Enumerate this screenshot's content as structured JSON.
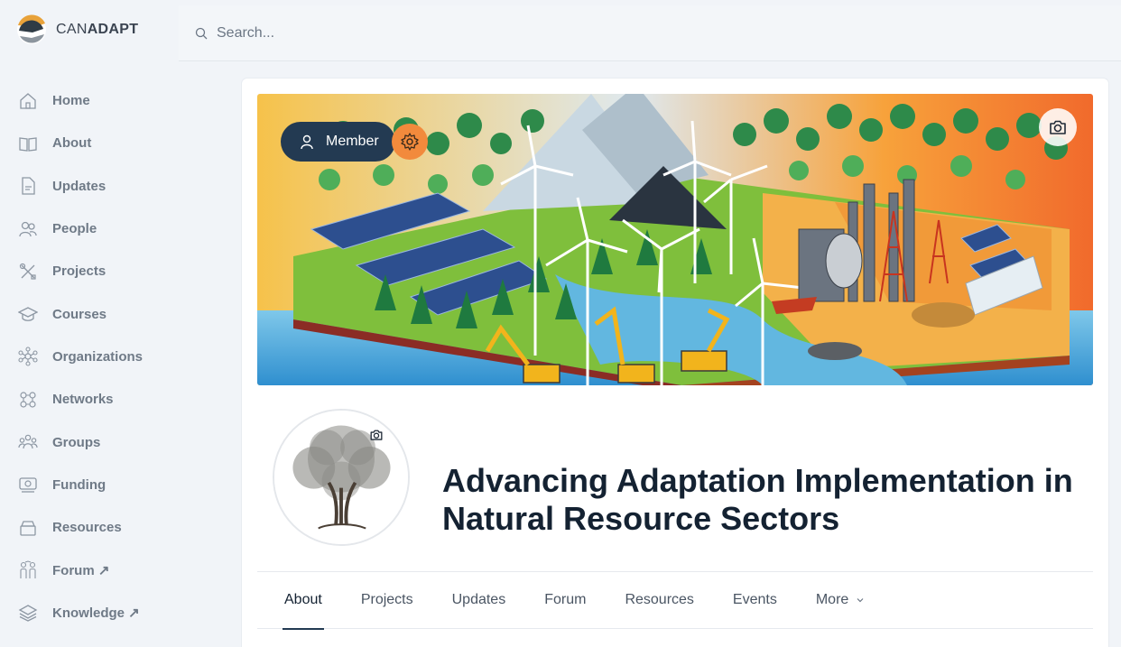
{
  "brand": {
    "name_prefix": "CAN",
    "name_suffix": "ADAPT",
    "logo_icon": "canadapt-logo"
  },
  "search": {
    "placeholder": "Search...",
    "value": ""
  },
  "sidebar": {
    "items": [
      {
        "label": "Home",
        "icon": "home-icon"
      },
      {
        "label": "About",
        "icon": "book-icon"
      },
      {
        "label": "Updates",
        "icon": "document-icon"
      },
      {
        "label": "People",
        "icon": "people-icon"
      },
      {
        "label": "Projects",
        "icon": "tools-icon"
      },
      {
        "label": "Courses",
        "icon": "graduation-cap-icon"
      },
      {
        "label": "Organizations",
        "icon": "network-hub-icon"
      },
      {
        "label": "Networks",
        "icon": "network-icon"
      },
      {
        "label": "Groups",
        "icon": "groups-icon"
      },
      {
        "label": "Funding",
        "icon": "money-icon"
      },
      {
        "label": "Resources",
        "icon": "archive-icon"
      },
      {
        "label": "Forum ↗",
        "icon": "forum-icon"
      },
      {
        "label": "Knowledge ↗",
        "icon": "layers-icon"
      }
    ]
  },
  "banner": {
    "member_label": "Member",
    "member_icon": "user-icon",
    "settings_icon": "gear-icon",
    "camera_icon": "camera-icon"
  },
  "group": {
    "title": "Advancing Adaptation Implementation in Natural Resource Sectors",
    "avatar_icon": "oak-tree-avatar"
  },
  "tabs": [
    {
      "label": "About",
      "active": true
    },
    {
      "label": "Projects",
      "active": false
    },
    {
      "label": "Updates",
      "active": false
    },
    {
      "label": "Forum",
      "active": false
    },
    {
      "label": "Resources",
      "active": false
    },
    {
      "label": "Events",
      "active": false
    },
    {
      "label": "More",
      "active": false
    }
  ],
  "colors": {
    "accent": "#233a52",
    "settings": "#f28a3c",
    "page_bg": "#f1f4f8"
  }
}
